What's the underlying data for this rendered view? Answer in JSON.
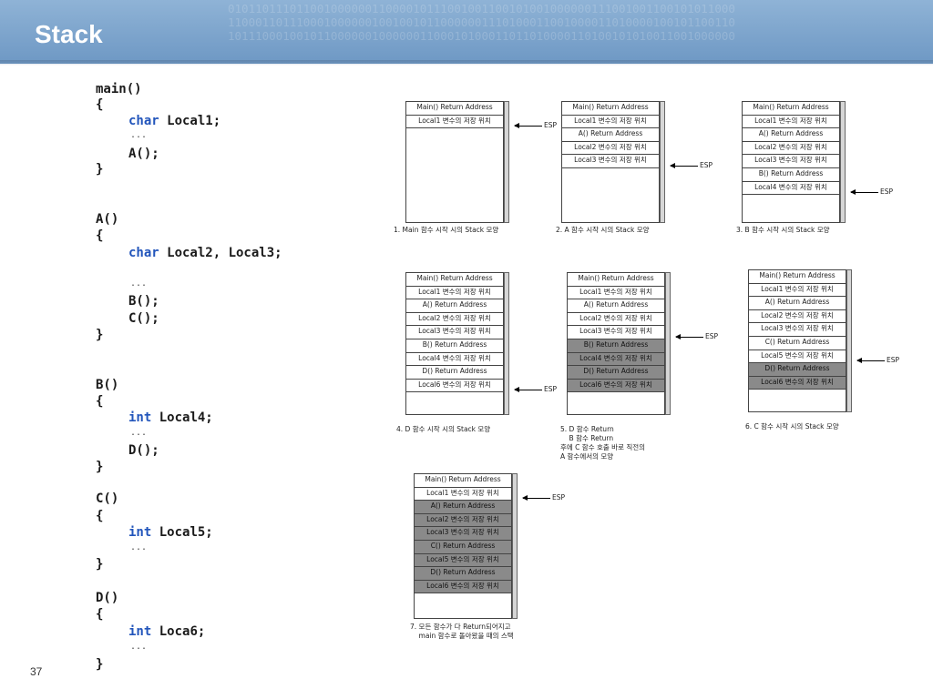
{
  "slide": {
    "title": "Stack",
    "page_number": "37",
    "background_binary": "01011011101100100000011000010111001001100101001000000111001001100101011000\n11000110111000100000010010010110000001110100011001000011010000100101100110\n10111000100101100000010000001100010100011011010000110100101010011001000000"
  },
  "code": [
    {
      "parts": [
        {
          "t": "main()"
        }
      ]
    },
    {
      "parts": [
        {
          "t": "{"
        }
      ]
    },
    {
      "parts": [
        {
          "t": "char",
          "kw": true
        },
        {
          "t": " Local1;"
        }
      ]
    },
    {
      "parts": [
        {
          "t": "..."
        }
      ],
      "ellipsis": true
    },
    {
      "parts": [
        {
          "t": "A();"
        }
      ]
    },
    {
      "parts": [
        {
          "t": "}"
        }
      ]
    },
    {
      "parts": [
        {
          "t": "A()"
        }
      ]
    },
    {
      "parts": [
        {
          "t": "{"
        }
      ]
    },
    {
      "parts": [
        {
          "t": "char",
          "kw": true
        },
        {
          "t": " Local2, Local3;"
        }
      ]
    },
    {
      "parts": [
        {
          "t": "..."
        }
      ],
      "ellipsis": true
    },
    {
      "parts": [
        {
          "t": "B();"
        }
      ]
    },
    {
      "parts": [
        {
          "t": "C();"
        }
      ]
    },
    {
      "parts": [
        {
          "t": "}"
        }
      ]
    },
    {
      "parts": [
        {
          "t": "B()"
        }
      ]
    },
    {
      "parts": [
        {
          "t": "{"
        }
      ]
    },
    {
      "parts": [
        {
          "t": "int",
          "kw": true
        },
        {
          "t": " Local4;"
        }
      ]
    },
    {
      "parts": [
        {
          "t": "..."
        }
      ],
      "ellipsis": true
    },
    {
      "parts": [
        {
          "t": "D();"
        }
      ]
    },
    {
      "parts": [
        {
          "t": "}"
        }
      ]
    },
    {
      "parts": [
        {
          "t": "C()"
        }
      ]
    },
    {
      "parts": [
        {
          "t": "{"
        }
      ]
    },
    {
      "parts": [
        {
          "t": "int",
          "kw": true
        },
        {
          "t": " Local5;"
        }
      ]
    },
    {
      "parts": [
        {
          "t": "..."
        }
      ],
      "ellipsis": true
    },
    {
      "parts": [
        {
          "t": "}"
        }
      ]
    },
    {
      "parts": [
        {
          "t": "D()"
        }
      ]
    },
    {
      "parts": [
        {
          "t": "{"
        }
      ]
    },
    {
      "parts": [
        {
          "t": "int",
          "kw": true
        },
        {
          "t": " Loca6;"
        }
      ]
    },
    {
      "parts": [
        {
          "t": "..."
        }
      ],
      "ellipsis": true
    },
    {
      "parts": [
        {
          "t": "}"
        }
      ]
    }
  ],
  "esp_label": "ESP",
  "colors": {
    "header": "#7aa2cc",
    "keyword": "#2255bb",
    "shaded_cell": "#8a8a8a"
  },
  "stacks": [
    {
      "caption": "1. Main 함수 시작 시의 Stack 모양",
      "cells": [
        {
          "text": "Main() Return Address",
          "shaded": false
        },
        {
          "text": "Local1 변수의 저장 위치",
          "shaded": false
        }
      ],
      "esp_after_cell": 2
    },
    {
      "caption": "2. A 함수 시작 시의 Stack 모양",
      "cells": [
        {
          "text": "Main() Return Address",
          "shaded": false
        },
        {
          "text": "Local1 변수의 저장 위치",
          "shaded": false
        },
        {
          "text": "A() Return Address",
          "shaded": false
        },
        {
          "text": "Local2 변수의 저장 위치",
          "shaded": false
        },
        {
          "text": "Local3 변수의 저장 위치",
          "shaded": false
        }
      ],
      "esp_after_cell": 5
    },
    {
      "caption": "3. B 함수 시작 시의 Stack 모양",
      "cells": [
        {
          "text": "Main() Return Address",
          "shaded": false
        },
        {
          "text": "Local1 변수의 저장 위치",
          "shaded": false
        },
        {
          "text": "A() Return Address",
          "shaded": false
        },
        {
          "text": "Local2 변수의 저장 위치",
          "shaded": false
        },
        {
          "text": "Local3 변수의 저장 위치",
          "shaded": false
        },
        {
          "text": "B() Return Address",
          "shaded": false
        },
        {
          "text": "Local4 변수의 저장 위치",
          "shaded": false
        }
      ],
      "esp_after_cell": 7
    },
    {
      "caption": "4. D 함수 시작 시의 Stack 모양",
      "cells": [
        {
          "text": "Main() Return Address",
          "shaded": false
        },
        {
          "text": "Local1 변수의 저장 위치",
          "shaded": false
        },
        {
          "text": "A() Return Address",
          "shaded": false
        },
        {
          "text": "Local2 변수의 저장 위치",
          "shaded": false
        },
        {
          "text": "Local3 변수의 저장 위치",
          "shaded": false
        },
        {
          "text": "B() Return Address",
          "shaded": false
        },
        {
          "text": "Local4 변수의 저장 위치",
          "shaded": false
        },
        {
          "text": "D() Return Address",
          "shaded": false
        },
        {
          "text": "Local6 변수의 저장 위치",
          "shaded": false
        }
      ],
      "esp_after_cell": 9
    },
    {
      "caption": "5. D 함수 Return\n    B 함수 Return\n후에 C 함수 호출 바로 직전의\nA 함수에서의 모양",
      "cells": [
        {
          "text": "Main() Return Address",
          "shaded": false
        },
        {
          "text": "Local1 변수의 저장 위치",
          "shaded": false
        },
        {
          "text": "A() Return Address",
          "shaded": false
        },
        {
          "text": "Local2 변수의 저장 위치",
          "shaded": false
        },
        {
          "text": "Local3 변수의 저장 위치",
          "shaded": false
        },
        {
          "text": "B() Return Address",
          "shaded": true
        },
        {
          "text": "Local4 변수의 저장 위치",
          "shaded": true
        },
        {
          "text": "D() Return Address",
          "shaded": true
        },
        {
          "text": "Local6 변수의 저장 위치",
          "shaded": true
        }
      ],
      "esp_after_cell": 5
    },
    {
      "caption": "6. C 함수 시작 시의 Stack 모양",
      "cells": [
        {
          "text": "Main() Return Address",
          "shaded": false
        },
        {
          "text": "Local1 변수의 저장 위치",
          "shaded": false
        },
        {
          "text": "A() Return Address",
          "shaded": false
        },
        {
          "text": "Local2 변수의 저장 위치",
          "shaded": false
        },
        {
          "text": "Local3 변수의 저장 위치",
          "shaded": false
        },
        {
          "text": "C() Return Address",
          "shaded": false
        },
        {
          "text": "Local5 변수의 저장 위치",
          "shaded": false
        },
        {
          "text": "D() Return Address",
          "shaded": true
        },
        {
          "text": "Local6 변수의 저장 위치",
          "shaded": true
        }
      ],
      "esp_after_cell": 7
    },
    {
      "caption": "7. 모든 함수가 다 Return되어지고\n    main 함수로 돌아왔을 때의 스택",
      "cells": [
        {
          "text": "Main() Return Address",
          "shaded": false
        },
        {
          "text": "Local1 변수의 저장 위치",
          "shaded": false
        },
        {
          "text": "A() Return Address",
          "shaded": true
        },
        {
          "text": "Local2 변수의 저장 위치",
          "shaded": true
        },
        {
          "text": "Local3 변수의 저장 위치",
          "shaded": true
        },
        {
          "text": "C() Return Address",
          "shaded": true
        },
        {
          "text": "Local5 변수의 저장 위치",
          "shaded": true
        },
        {
          "text": "D() Return Address",
          "shaded": true
        },
        {
          "text": "Local6 변수의 저장 위치",
          "shaded": true
        }
      ],
      "esp_after_cell": 2
    }
  ]
}
